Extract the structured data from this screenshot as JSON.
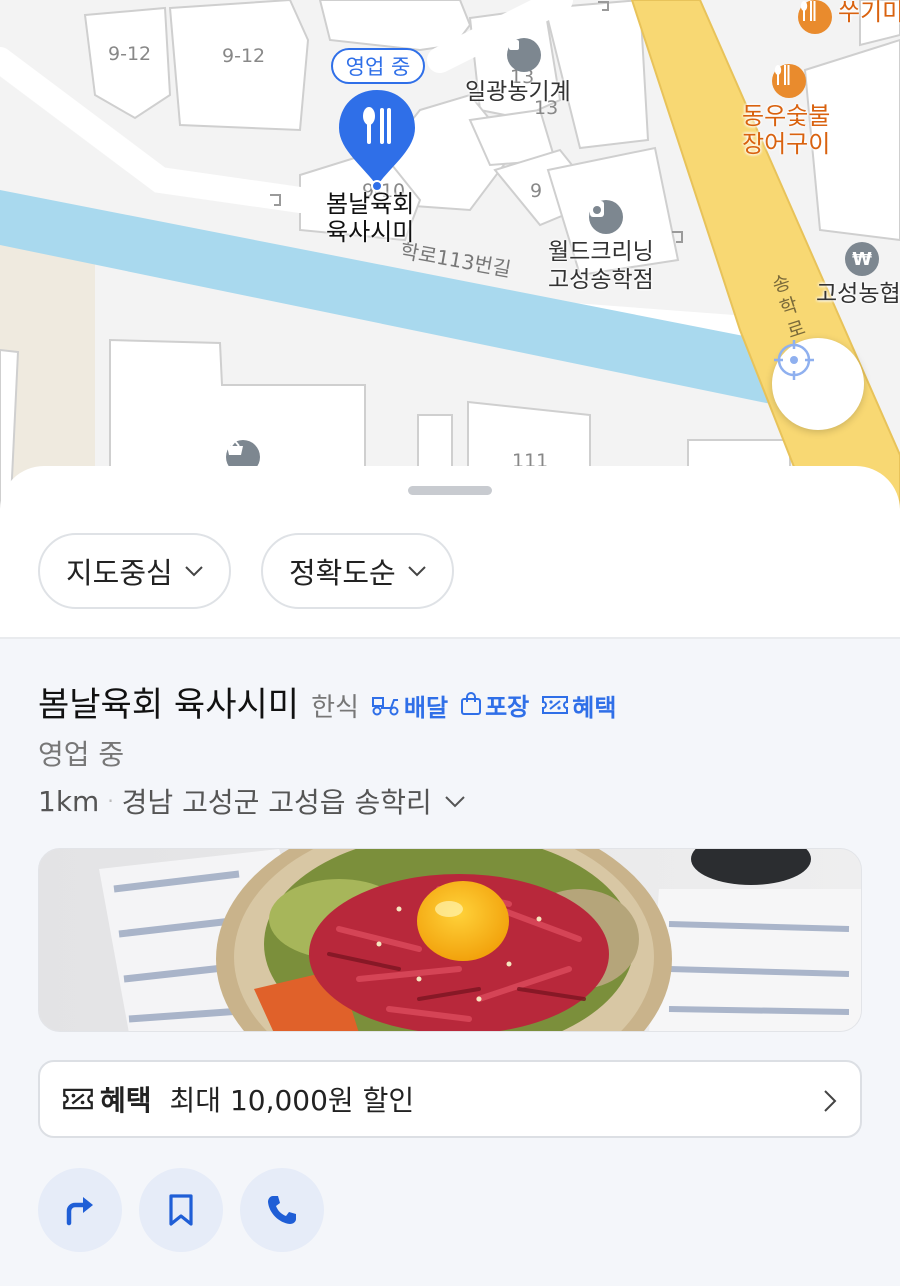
{
  "map": {
    "open_badge": "영업 중",
    "pin_label_line1": "봄날육회",
    "pin_label_line2": "육사시미",
    "street_label": "학로113번길",
    "road_label_vertical": "송학로",
    "lot_numbers": [
      "9-12",
      "9-12",
      "13",
      "13",
      "9",
      "9-10",
      "111"
    ],
    "pois": [
      {
        "name": "일광농기계",
        "icon": "square-dot-icon"
      },
      {
        "name_line1": "동우숯불",
        "name_line2": "장어구이",
        "icon": "fork-spoon-icon"
      },
      {
        "name": "쑤기미",
        "icon": "fork-spoon-icon"
      },
      {
        "name_line1": "월드크리닝",
        "name_line2": "고성송학점",
        "icon": "laundry-icon"
      },
      {
        "name": "고성농협",
        "icon": "won-icon"
      }
    ],
    "colors": {
      "road_yellow": "#f8d873",
      "river_blue": "#a9d9ee",
      "accent_blue": "#2f6fe8",
      "poi_orange": "#e98b2d"
    }
  },
  "filters": {
    "location": "지도중심",
    "sort": "정확도순"
  },
  "result": {
    "name": "봄날육회 육사시미",
    "category": "한식",
    "tags": [
      "배달",
      "포장",
      "혜택"
    ],
    "status": "영업 중",
    "distance": "1km",
    "address": "경남 고성군 고성읍 송학리",
    "benefit_label": "혜택",
    "benefit_text": "최대 10,000원 할인"
  },
  "actions": [
    "directions-icon",
    "bookmark-icon",
    "phone-icon"
  ]
}
